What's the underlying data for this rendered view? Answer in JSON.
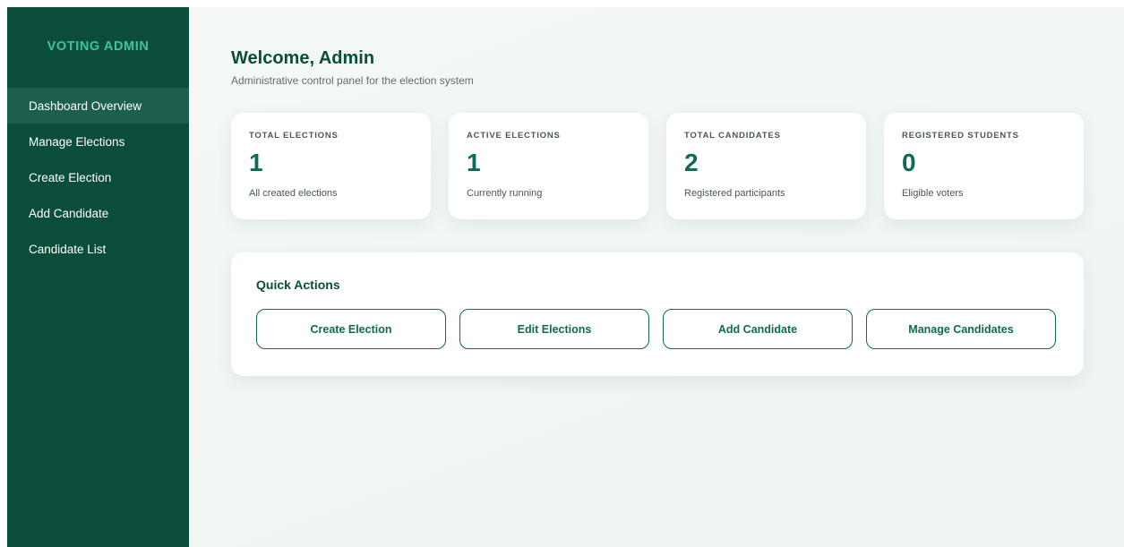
{
  "sidebar": {
    "brand": "VOTING ADMIN",
    "items": [
      {
        "label": "Dashboard Overview",
        "active": true
      },
      {
        "label": "Manage Elections",
        "active": false
      },
      {
        "label": "Create Election",
        "active": false
      },
      {
        "label": "Add Candidate",
        "active": false
      },
      {
        "label": "Candidate List",
        "active": false
      }
    ]
  },
  "header": {
    "title": "Welcome, Admin",
    "subtitle": "Administrative control panel for the election system"
  },
  "stats": [
    {
      "label": "TOTAL ELECTIONS",
      "value": "1",
      "desc": "All created elections"
    },
    {
      "label": "ACTIVE ELECTIONS",
      "value": "1",
      "desc": "Currently running"
    },
    {
      "label": "TOTAL CANDIDATES",
      "value": "2",
      "desc": "Registered participants"
    },
    {
      "label": "REGISTERED STUDENTS",
      "value": "0",
      "desc": "Eligible voters"
    }
  ],
  "quick_actions": {
    "title": "Quick Actions",
    "buttons": [
      "Create Election",
      "Edit Elections",
      "Add Candidate",
      "Manage Candidates"
    ]
  },
  "colors": {
    "sidebar_bg": "#0b4d3b",
    "sidebar_active": "#1b5f4c",
    "brand_accent": "#3fc49a",
    "primary": "#0e6b54",
    "background": "#eef4f1"
  }
}
